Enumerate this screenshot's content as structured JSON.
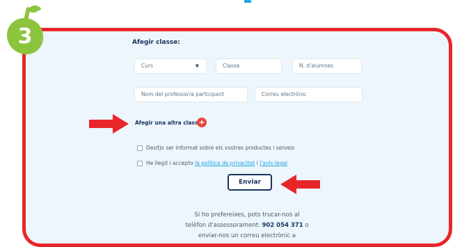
{
  "step_badge": {
    "number": "3"
  },
  "form": {
    "title": "Afegir classe:",
    "course_select": {
      "value": "Curs"
    },
    "class_field": {
      "placeholder": "Classe"
    },
    "students_field": {
      "placeholder": "N. d'alumnes"
    },
    "teacher_field": {
      "placeholder": "Nom del professor/a participant"
    },
    "email_field": {
      "placeholder": "Correu electrònic"
    },
    "add_class_label": "Afegir una altra classe",
    "add_class_icon": "plus-icon",
    "info_checkbox_label": "Desitjo ser informat sobre els vostres productes i serveis",
    "privacy_prefix": "He llegit i accepto",
    "privacy_link": "la política de privacitat",
    "privacy_join": "i",
    "legal_link": "l'avís legal",
    "submit_label": "Enviar"
  },
  "footer": {
    "line1": "Si ho prefereixes, pots trucar-nos al",
    "line2_prefix": "telèfon d'assessorament:",
    "phone": "902 054 371",
    "line2_suffix": "o",
    "line3": "enviar-nos un correu electrònic a"
  },
  "colors": {
    "frame": "#e8262a",
    "badge": "#8cc43e",
    "accent_link": "#1fa5e3",
    "navy_text": "#16325c",
    "add_icon": "#e8453c",
    "panel_bg": "#ecf6fc"
  }
}
